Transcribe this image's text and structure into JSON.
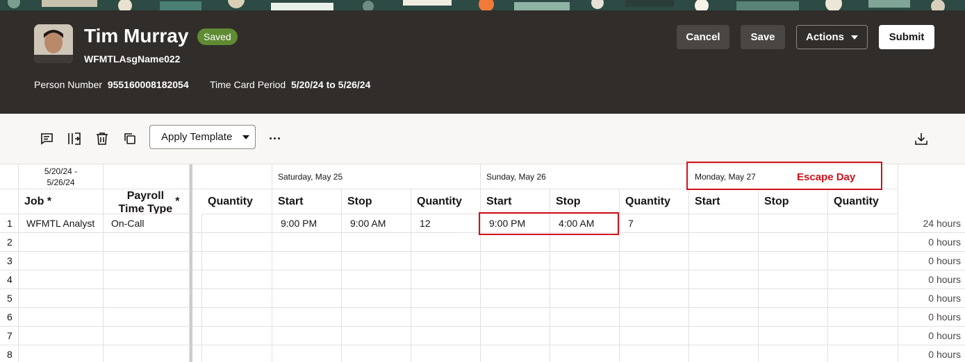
{
  "colors": {
    "header_bg": "#312d2a",
    "saved_badge": "#5e8b33",
    "highlight": "#d0101b"
  },
  "person": {
    "name": "Tim Murray",
    "status": "Saved",
    "assignment": "WFMTLAsgName022",
    "person_number_label": "Person Number",
    "person_number": "955160008182054",
    "period_label": "Time Card Period",
    "period": "5/20/24 to 5/26/24"
  },
  "header_buttons": {
    "cancel": "Cancel",
    "save": "Save",
    "actions": "Actions",
    "submit": "Submit"
  },
  "toolbar": {
    "icons": [
      "comment-icon",
      "split-columns-icon",
      "delete-icon",
      "copy-icon",
      "more-icon",
      "download-icon"
    ],
    "apply_template": "Apply Template",
    "more": "···"
  },
  "grid": {
    "period_header": "5/20/24 -\n5/26/24",
    "days": [
      "Saturday, May 25",
      "Sunday, May 26",
      "Monday, May 27"
    ],
    "escape_label": "Escape Day",
    "columns": {
      "job": "Job *",
      "payroll_time_type": "Payroll\nTime Type",
      "payroll_required": "*",
      "quantity": "Quantity",
      "start": "Start",
      "stop": "Stop"
    },
    "rows": [
      {
        "num": "1",
        "job": "WFMTL Analyst",
        "type": "On-Call",
        "sat_start": "9:00 PM",
        "sat_stop": "9:00 AM",
        "sat_qty": "12",
        "sun_start": "9:00 PM",
        "sun_stop": "4:00 AM",
        "sun_qty": "7",
        "total": "24 hours"
      },
      {
        "num": "2",
        "total": "0 hours"
      },
      {
        "num": "3",
        "total": "0 hours"
      },
      {
        "num": "4",
        "total": "0 hours"
      },
      {
        "num": "5",
        "total": "0 hours"
      },
      {
        "num": "6",
        "total": "0 hours"
      },
      {
        "num": "7",
        "total": "0 hours"
      },
      {
        "num": "8",
        "total": "0 hours"
      }
    ]
  }
}
